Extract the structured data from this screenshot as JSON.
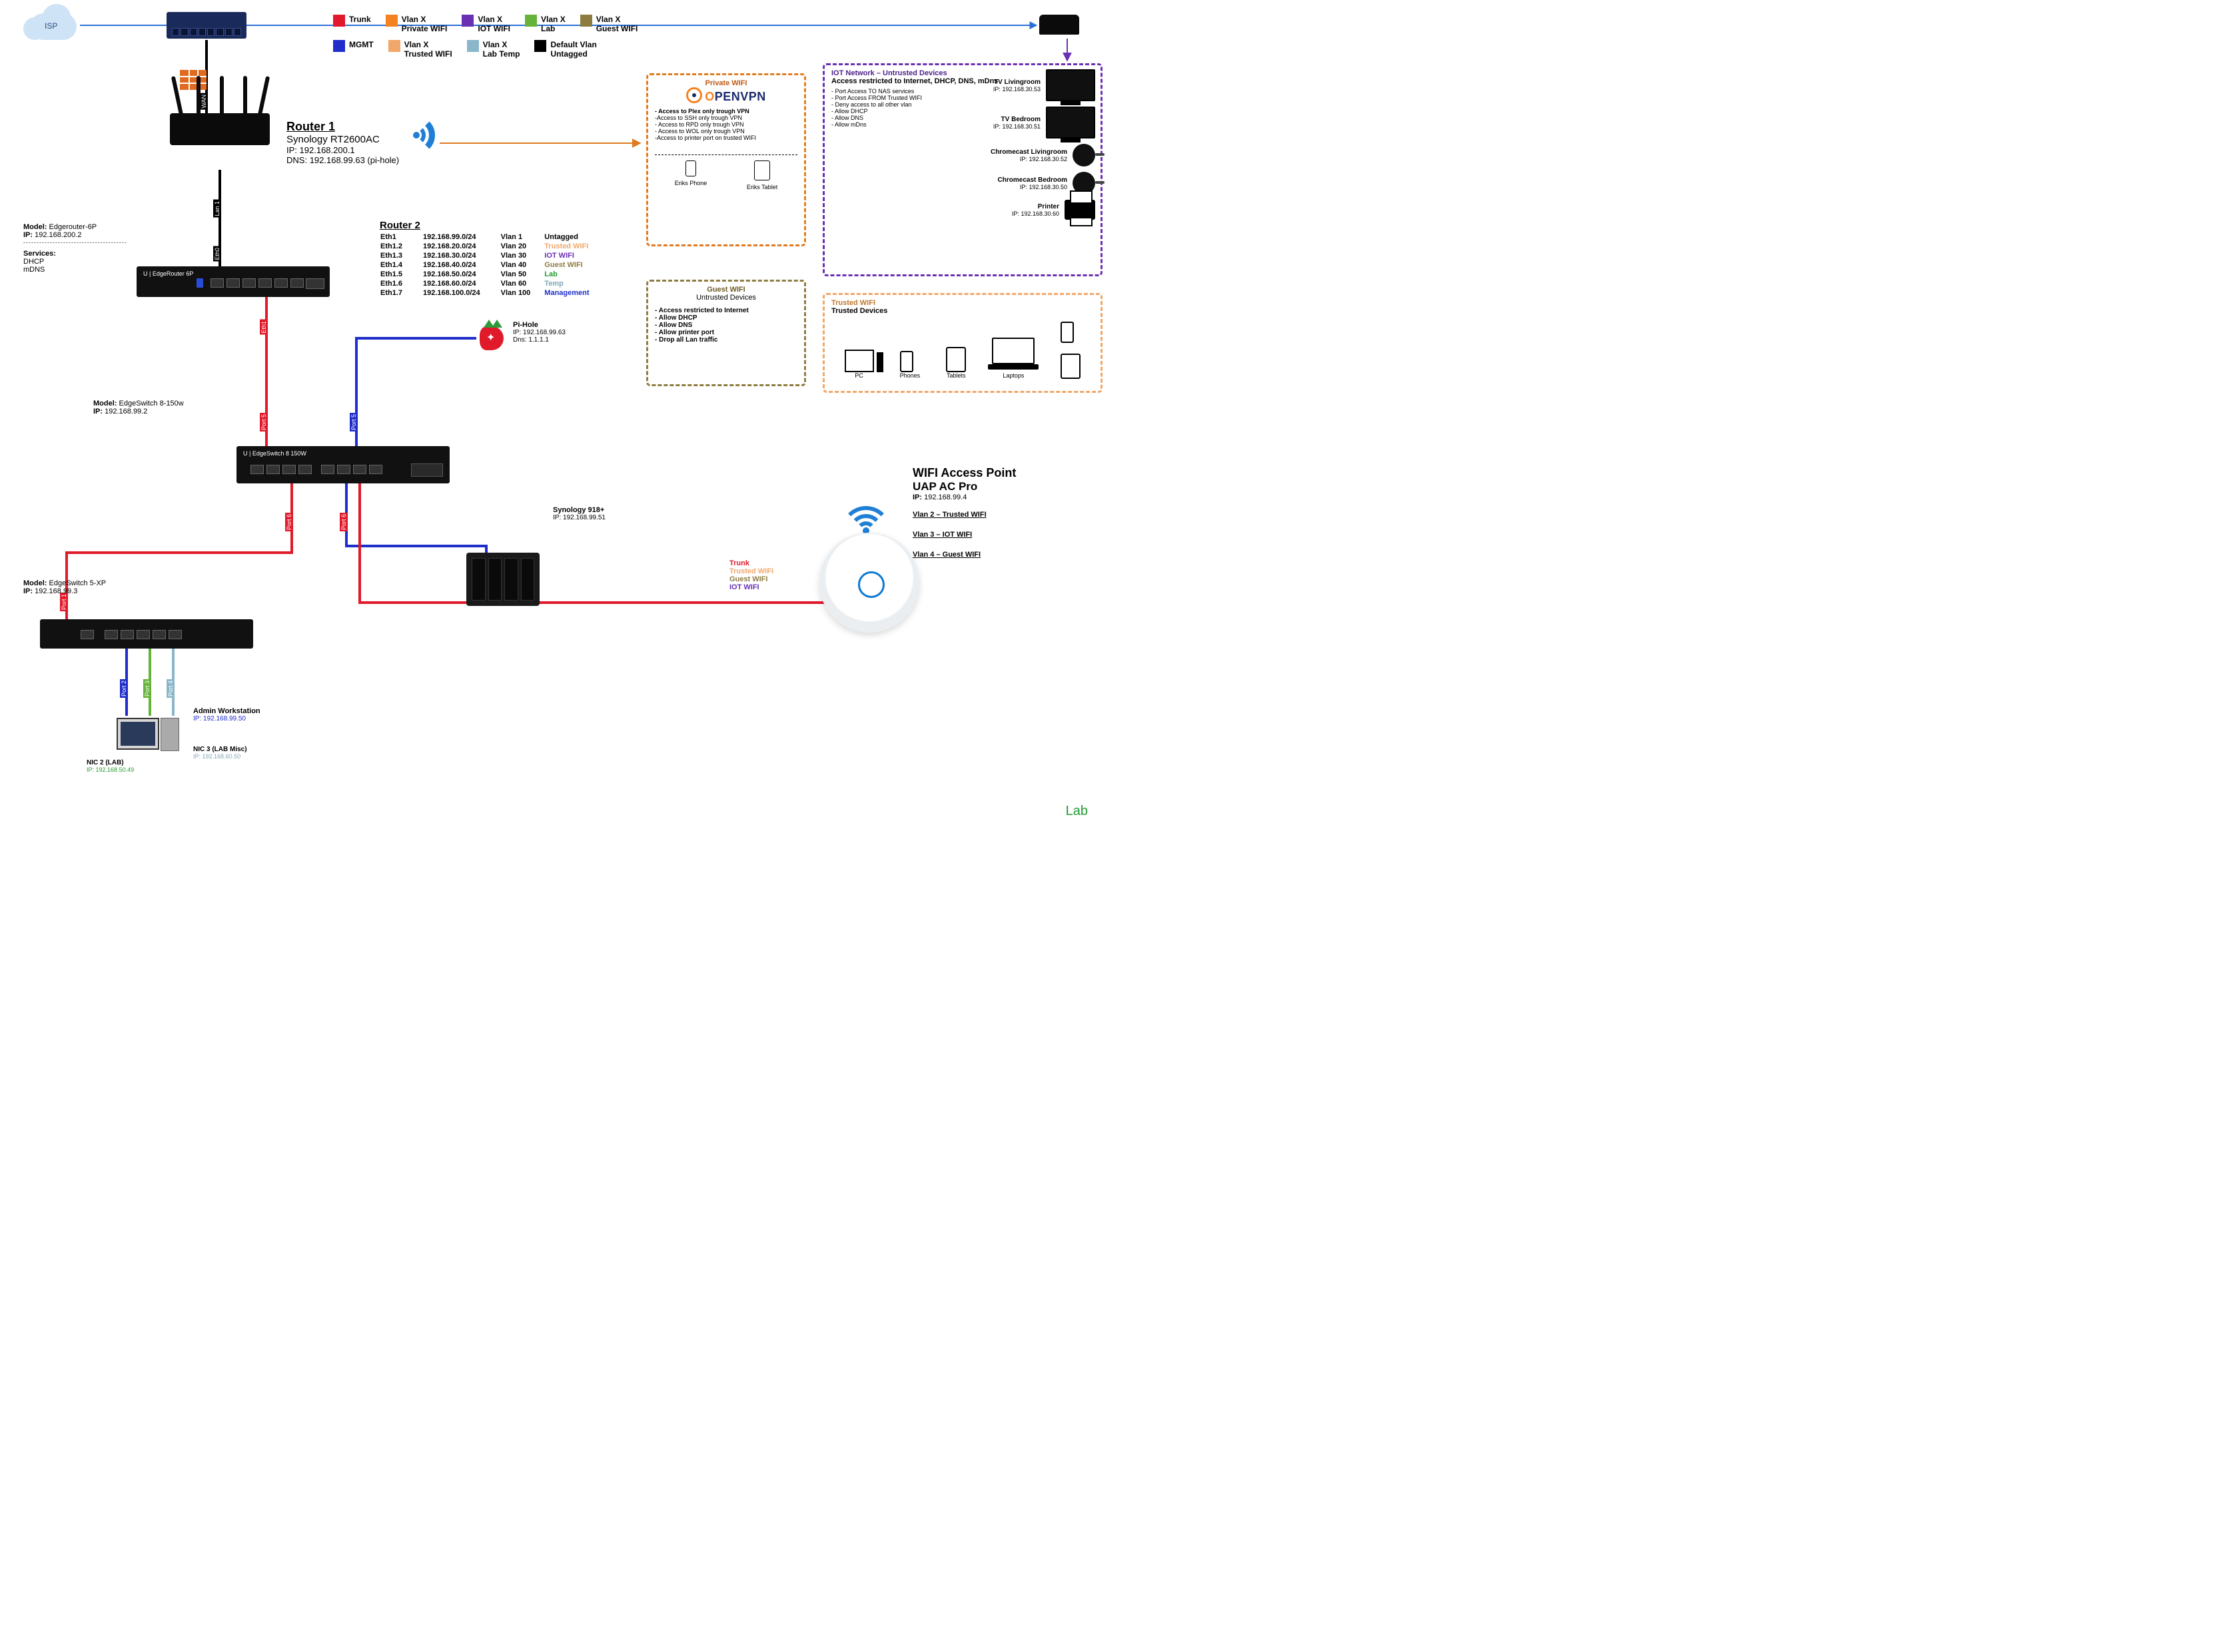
{
  "colors": {
    "trunk": "#e11a2b",
    "mgmt": "#1f2ecb",
    "private_wifi": "#f58220",
    "trusted_wifi": "#f1a76a",
    "iot_wifi": "#6a2fb3",
    "lab_temp": "#8bb6c9",
    "lab": "#66b23a",
    "default_vlan": "#000000",
    "guest_wifi": "#8d7b3f",
    "temp": "#7fa7b5"
  },
  "legend": [
    {
      "color": "#e11a2b",
      "label": "Trunk"
    },
    {
      "color": "#1f2ecb",
      "label": "MGMT"
    },
    {
      "color": "#f58220",
      "label": "Vlan X\nPrivate WIFI"
    },
    {
      "color": "#f1a76a",
      "label": "Vlan X\nTrusted WIFI"
    },
    {
      "color": "#6a2fb3",
      "label": "Vlan X\nIOT WIFI"
    },
    {
      "color": "#8bb6c9",
      "label": "Vlan X\nLab Temp"
    },
    {
      "color": "#66b23a",
      "label": "Vlan X\nLab"
    },
    {
      "color": "#000000",
      "label": "Default Vlan\nUntagged"
    },
    {
      "color": "#8d7b3f",
      "label": "Vlan X\nGuest WIFI"
    }
  ],
  "isp": {
    "label": "ISP"
  },
  "modem_switch": {
    "name": "netgear-switch-icon"
  },
  "cable_labels": {
    "wan": "WAN",
    "lan1": "Lan 1",
    "eth0": "Eth0",
    "eth1": "Eth1",
    "port5a": "Port 5",
    "port5b": "Port 5",
    "port6a": "Port 6",
    "port6b": "Port 6",
    "port1": "Port 1",
    "port2": "Port 2",
    "port3": "Port 3",
    "port4": "Port 4"
  },
  "router1": {
    "title": "Router 1",
    "model": "Synology RT2600AC",
    "ip_label": "IP:",
    "ip": "192.168.200.1",
    "dns_label": "DNS:",
    "dns": "192.168.99.63 (pi-hole)"
  },
  "edgerouter": {
    "model_label": "Model:",
    "model": "Edgerouter-6P",
    "ip_label": "IP:",
    "ip": "192.168.200.2",
    "sep": "---------------------------------------",
    "services_label": "Services:",
    "services": [
      "DHCP",
      "mDNS"
    ],
    "badge": "EdgeRouter 6P"
  },
  "router2": {
    "title": "Router 2",
    "rows": [
      {
        "eth": "Eth1",
        "subnet": "192.168.99.0/24",
        "vlan": "Vlan 1",
        "name": "Untagged",
        "color": "#000000"
      },
      {
        "eth": "Eth1.2",
        "subnet": "192.168.20.0/24",
        "vlan": "Vlan 20",
        "name": "Trusted WIFI",
        "color": "#f1a76a"
      },
      {
        "eth": "Eth1.3",
        "subnet": "192.168.30.0/24",
        "vlan": "Vlan 30",
        "name": "IOT WIFI",
        "color": "#6a2fb3"
      },
      {
        "eth": "Eth1.4",
        "subnet": "192.168.40.0/24",
        "vlan": "Vlan 40",
        "name": "Guest WIFI",
        "color": "#8d7b3f"
      },
      {
        "eth": "Eth1.5",
        "subnet": "192.168.50.0/24",
        "vlan": "Vlan 50",
        "name": "Lab",
        "color": "#1f9b2f"
      },
      {
        "eth": "Eth1.6",
        "subnet": "192.168.60.0/24",
        "vlan": "Vlan 60",
        "name": "Temp",
        "color": "#7fa7b5"
      },
      {
        "eth": "Eth1.7",
        "subnet": "192.168.100.0/24",
        "vlan": "Vlan 100",
        "name": "Management",
        "color": "#1f2ecb"
      }
    ]
  },
  "pihole": {
    "title": "Pi-Hole",
    "ip_label": "IP:",
    "ip": "192.168.99.63",
    "dns_label": "Dns:",
    "dns": "1.1.1.1"
  },
  "edgeswitch8": {
    "model_label": "Model:",
    "model": "EdgeSwitch 8-150w",
    "ip_label": "IP:",
    "ip": "192.168.99.2",
    "badge": "EdgeSwitch 8 150W"
  },
  "edgeswitch5": {
    "model_label": "Model:",
    "model": "EdgeSwitch 5-XP",
    "ip_label": "IP:",
    "ip": "192.168.99.3"
  },
  "synology_nas": {
    "title": "Synology 918+",
    "ip_label": "IP:",
    "ip": "192.168.99.51"
  },
  "workstation": {
    "title": "Admin Workstation",
    "ip_label": "IP:",
    "ip": "192.168.99.50",
    "nic2_label": "NIC 2 (LAB)",
    "nic2_ip_label": "IP:",
    "nic2_ip": "192.168.50.49",
    "nic3_label": "NIC 3 (LAB Misc)",
    "nic3_ip_label": "IP:",
    "nic3_ip": "192.168.60.50"
  },
  "ap": {
    "title": "WIFI Access Point",
    "model": "UAP AC Pro",
    "ip_label": "IP:",
    "ip": "192.168.99.4",
    "vlans": [
      "Vlan 2 – Trusted WIFI",
      "Vlan 3 – IOT WIFI",
      "Vlan 4 – Guest WIFI"
    ],
    "legend": [
      {
        "label": "Trunk",
        "color": "#e11a2b"
      },
      {
        "label": "Trusted WIFI",
        "color": "#f1a76a"
      },
      {
        "label": "Guest WIFI",
        "color": "#8d7b3f"
      },
      {
        "label": "IOT WIFI",
        "color": "#6a2fb3"
      }
    ]
  },
  "zone_private": {
    "title": "Private WIFI",
    "brand": "OPENVPN",
    "rules": [
      "- Access to Plex only trough VPN",
      "-Access to SSH only trough VPN",
      "- Access to RPD only trough VPN",
      "- Access to WOL only trough VPN",
      "-Access to printer port on trusted WIFI"
    ],
    "devices": [
      {
        "name": "Eriks Phone"
      },
      {
        "name": "Eriks Tablet"
      }
    ]
  },
  "zone_guest": {
    "title": "Guest WIFI",
    "subtitle": "Untrusted Devices",
    "rules": [
      "- Access restricted to Internet",
      "- Allow DHCP",
      "- Allow DNS",
      "- Allow printer port",
      "- Drop all Lan traffic"
    ]
  },
  "zone_iot": {
    "title": "IOT Network – Untrusted Devices",
    "subtitle": "Access restricted to Internet, DHCP, DNS, mDns",
    "rules": [
      "- Port Access TO NAS services",
      "- Port Access FROM Trusted WIFI",
      "- Deny access to all other vlan",
      "- Allow DHCP",
      "- Allow DNS",
      "- Allow mDns"
    ],
    "devices": [
      {
        "name": "TV Livingroom",
        "ip": "192.168.30.53"
      },
      {
        "name": "TV Bedroom",
        "ip": "192.168.30.51"
      },
      {
        "name": "Chromecast Livingroom",
        "ip": "192.168.30.52"
      },
      {
        "name": "Chromecast Bedroom",
        "ip": "192.168.30.50"
      },
      {
        "name": "Printer",
        "ip": "192.168.30.60"
      }
    ]
  },
  "zone_trusted": {
    "title": "Trusted WIFI",
    "subtitle": "Trusted Devices",
    "devices": [
      "PC",
      "Phones",
      "Tablets",
      "Laptops"
    ]
  },
  "footer_lab": "Lab"
}
